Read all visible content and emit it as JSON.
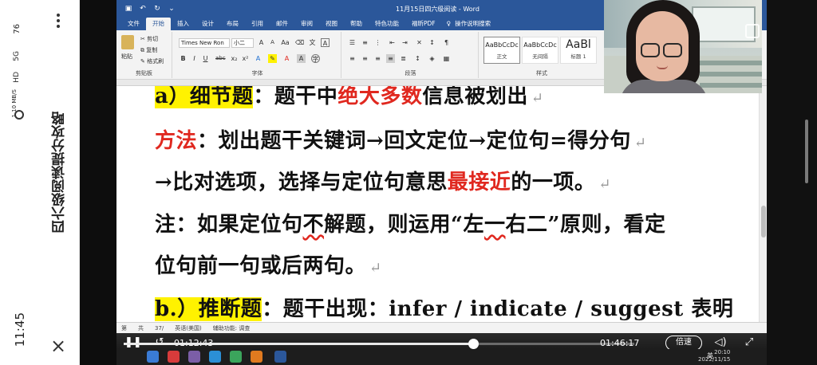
{
  "phone": {
    "time": "11:45",
    "net_speed": "1.10 MB/S",
    "net_type": "5G",
    "hd": "HD",
    "battery": "76",
    "title": "四六级阅读提分攻略"
  },
  "word": {
    "doc_title": "11月15日四六级阅读 - Word",
    "tabs": [
      "文件",
      "开始",
      "插入",
      "设计",
      "布局",
      "引用",
      "邮件",
      "审阅",
      "视图",
      "帮助",
      "特色功能",
      "福昕PDF"
    ],
    "active_tab": "开始",
    "tell_me": "操作说明搜索",
    "clipboard": {
      "paste": "粘贴",
      "cut": "剪切",
      "copy": "复制",
      "format_painter": "格式刷",
      "label": "剪贴板"
    },
    "font": {
      "name": "Times New Ron",
      "size": "小二",
      "label": "字体"
    },
    "paragraph_label": "段落",
    "styles": {
      "label": "样式",
      "items": [
        {
          "sample": "AaBbCcDc",
          "name": "正文"
        },
        {
          "sample": "AaBbCcDc",
          "name": "无间隔"
        },
        {
          "sample": "AaBl",
          "name": "标题 1"
        }
      ]
    },
    "statusbar": {
      "page": "第",
      "words": "共",
      "count": "37/",
      "lang": "英语(美国)",
      "accessibility": "辅助功能: 调查"
    }
  },
  "doc": {
    "line1": {
      "prefix": "a）细节题",
      "colon": "：题干中",
      "red": "绝大多数",
      "tail": "信息被划出"
    },
    "line2": {
      "label": "方法",
      "text": "：划出题干关键词→回文定位→定位句=得分句"
    },
    "line3": {
      "pre": "→比对选项，选择与定位句意思",
      "red": "最接近",
      "post": "的一项。"
    },
    "line4": {
      "a": "注：如果定位句",
      "sq": "不",
      "b": "解题，则运用“左",
      "sq2": "一",
      "c": "右二”原则，看定"
    },
    "line5": {
      "text": "位句前一句或后两句。"
    },
    "line6": {
      "label": "b.）推断题",
      "text": "：题干出现：infer / indicate / suggest 表明"
    },
    "para_mark": "↵"
  },
  "player": {
    "current_time": "01:12:43",
    "total_time": "01:46:17",
    "progress": 0.684,
    "speed_label": "倍速",
    "clock_time": "20:10",
    "clock_date": "2022/11/15",
    "ime": "英"
  }
}
